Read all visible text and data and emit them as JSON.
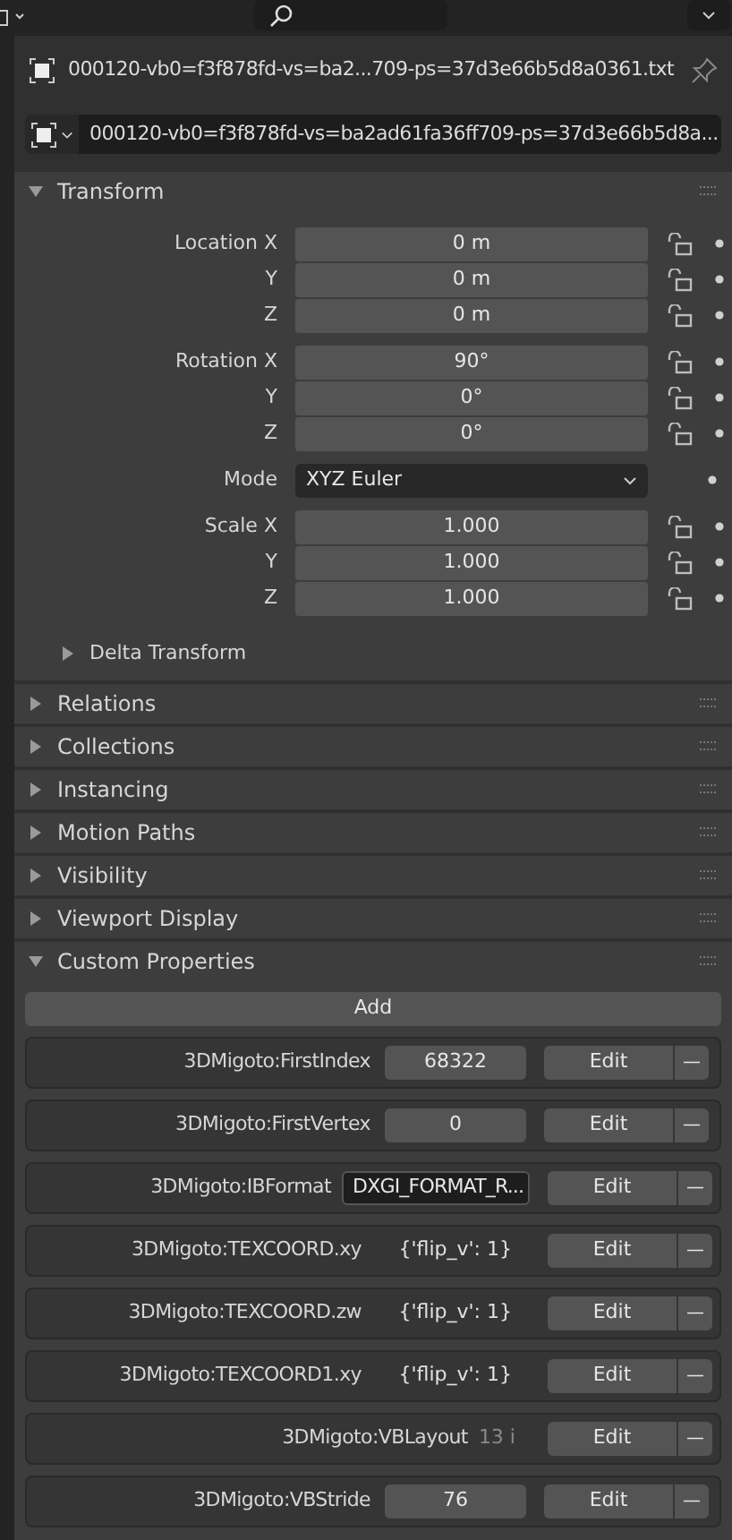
{
  "object": {
    "name": "000120-vb0=f3f878fd-vs=ba2...709-ps=37d3e66b5d8a0361.txt",
    "pinned": false
  },
  "data_block": {
    "name": "000120-vb0=f3f878fd-vs=ba2ad61fa36ff709-ps=37d3e66b5d8a..."
  },
  "transform": {
    "title": "Transform",
    "expanded": true,
    "groups": [
      {
        "rows": [
          {
            "label": "Location X",
            "value": "0 m"
          },
          {
            "label": "Y",
            "value": "0 m"
          },
          {
            "label": "Z",
            "value": "0 m"
          }
        ]
      },
      {
        "rows": [
          {
            "label": "Rotation X",
            "value": "90°"
          },
          {
            "label": "Y",
            "value": "0°"
          },
          {
            "label": "Z",
            "value": "0°"
          }
        ]
      },
      {
        "mode": {
          "label": "Mode",
          "value": "XYZ Euler"
        }
      },
      {
        "rows": [
          {
            "label": "Scale X",
            "value": "1.000"
          },
          {
            "label": "Y",
            "value": "1.000"
          },
          {
            "label": "Z",
            "value": "1.000"
          }
        ]
      }
    ],
    "delta": {
      "title": "Delta Transform",
      "expanded": false
    }
  },
  "sections": [
    {
      "title": "Relations",
      "expanded": false
    },
    {
      "title": "Collections",
      "expanded": false
    },
    {
      "title": "Instancing",
      "expanded": false
    },
    {
      "title": "Motion Paths",
      "expanded": false
    },
    {
      "title": "Visibility",
      "expanded": false
    },
    {
      "title": "Viewport Display",
      "expanded": false
    },
    {
      "title": "Custom Properties",
      "expanded": true
    }
  ],
  "custom_properties": {
    "add_label": "Add",
    "items": [
      {
        "name": "3DMigoto:FirstIndex",
        "kind": "number",
        "value": "68322",
        "edit_label": "Edit",
        "remove_label": "—"
      },
      {
        "name": "3DMigoto:FirstVertex",
        "kind": "number",
        "value": "0",
        "edit_label": "Edit",
        "remove_label": "—"
      },
      {
        "name": "3DMigoto:IBFormat",
        "kind": "text",
        "value": "DXGI_FORMAT_R...",
        "edit_label": "Edit",
        "remove_label": "—"
      },
      {
        "name": "3DMigoto:TEXCOORD.xy",
        "kind": "plain",
        "value": "{'flip_v': 1}",
        "edit_label": "Edit",
        "remove_label": "—"
      },
      {
        "name": "3DMigoto:TEXCOORD.zw",
        "kind": "plain",
        "value": "{'flip_v': 1}",
        "edit_label": "Edit",
        "remove_label": "—"
      },
      {
        "name": "3DMigoto:TEXCOORD1.xy",
        "kind": "plain",
        "value": "{'flip_v': 1}",
        "edit_label": "Edit",
        "remove_label": "—"
      },
      {
        "name": "3DMigoto:VBLayout",
        "kind": "faded",
        "value": "13 i",
        "edit_label": "Edit",
        "remove_label": "—"
      },
      {
        "name": "3DMigoto:VBStride",
        "kind": "number",
        "value": "76",
        "edit_label": "Edit",
        "remove_label": "—"
      }
    ]
  }
}
